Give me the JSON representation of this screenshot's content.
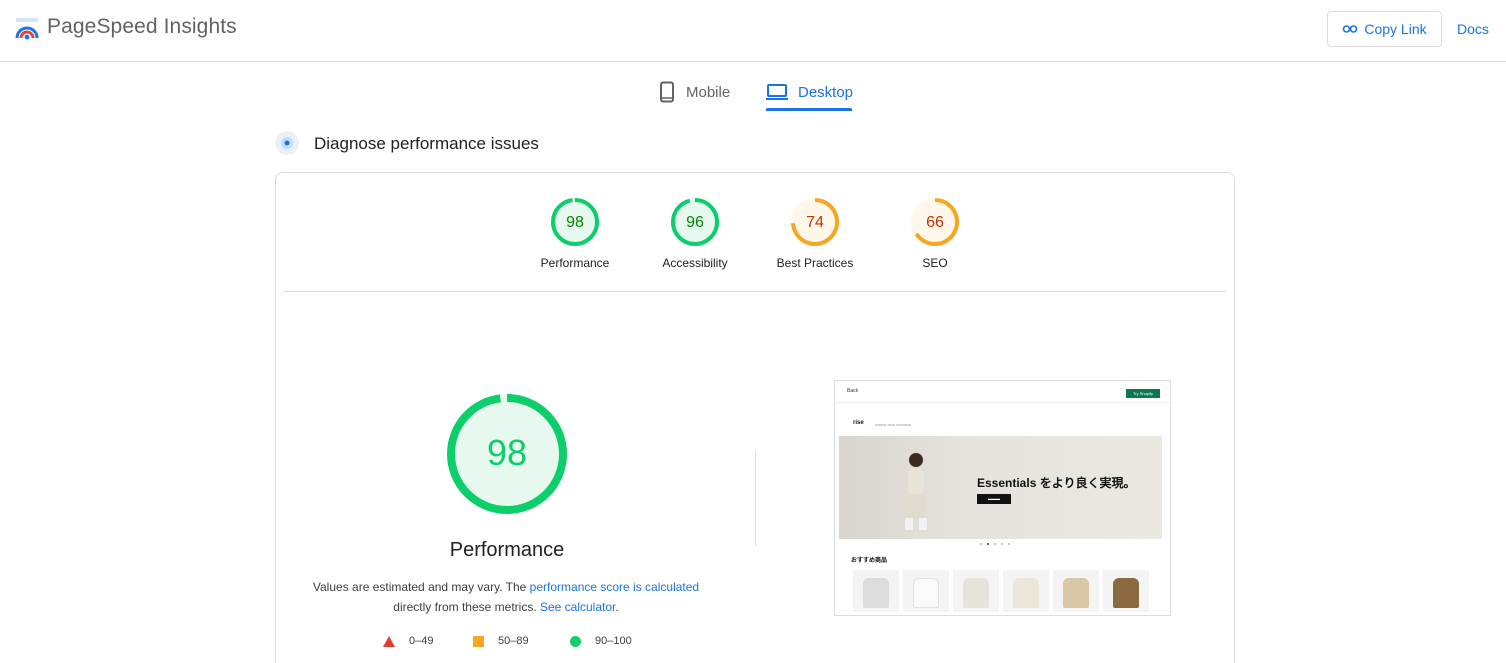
{
  "header": {
    "app_title": "PageSpeed Insights",
    "copy_link_label": "Copy Link",
    "docs_label": "Docs"
  },
  "tabs": [
    {
      "label": "Mobile",
      "icon": "phone-icon",
      "active": false
    },
    {
      "label": "Desktop",
      "icon": "laptop-icon",
      "active": true
    }
  ],
  "section": {
    "title": "Diagnose performance issues"
  },
  "colors": {
    "pass": "#0cce6b",
    "average": "#f7a623",
    "fail": "#e53935",
    "accent": "#1a73e8"
  },
  "gauges": [
    {
      "label": "Performance",
      "score": 98
    },
    {
      "label": "Accessibility",
      "score": 96
    },
    {
      "label": "Best Practices",
      "score": 74
    },
    {
      "label": "SEO",
      "score": 66
    }
  ],
  "main_gauge": {
    "score": 98,
    "label": "Performance"
  },
  "note": {
    "text_1": "Values are estimated and may vary. The ",
    "link_1": "performance score is calculated",
    "text_2": " directly from these metrics. ",
    "link_2": "See calculator",
    "text_3": "."
  },
  "legend": [
    {
      "range": "0–49",
      "shape": "triangle"
    },
    {
      "range": "50–89",
      "shape": "square"
    },
    {
      "range": "90–100",
      "shape": "circle"
    }
  ],
  "screenshot": {
    "back": "Back",
    "cta": "Try Shopify",
    "nav_logo": "rise",
    "hero_title": "Essentials をより良く実現。",
    "section_title": "おすすめ商品"
  }
}
